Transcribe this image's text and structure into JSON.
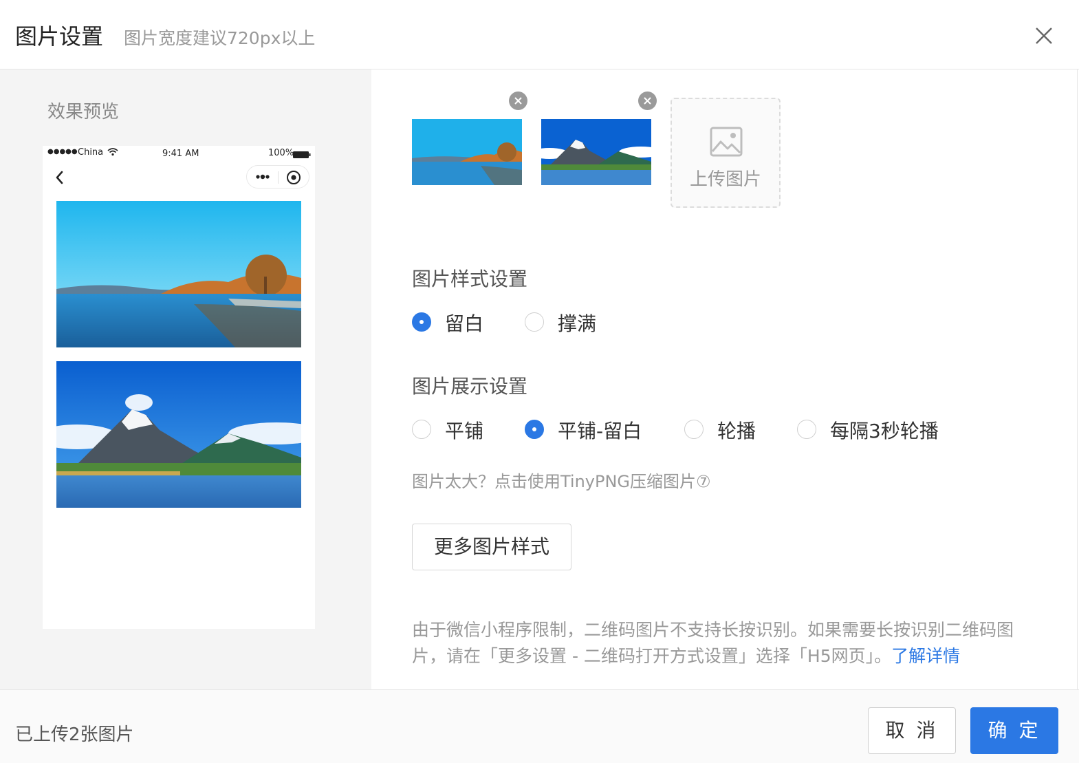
{
  "header": {
    "title": "图片设置",
    "subtitle": "图片宽度建议720px以上"
  },
  "preview": {
    "label": "效果预览",
    "statusbar": {
      "dots": "●●●●●",
      "carrier": "China",
      "time": "9:41 AM",
      "battery": "100%"
    },
    "images": [
      "lake-scene",
      "mountain-scene"
    ]
  },
  "thumbnails": [
    {
      "name": "lake-scene"
    },
    {
      "name": "mountain-scene"
    }
  ],
  "upload": {
    "label": "上传图片"
  },
  "style_setting": {
    "title": "图片样式设置",
    "options": [
      "留白",
      "撑满"
    ],
    "selected": "留白"
  },
  "display_setting": {
    "title": "图片展示设置",
    "options": [
      "平铺",
      "平铺-留白",
      "轮播",
      "每隔3秒轮播"
    ],
    "selected": "平铺-留白"
  },
  "tip": "图片太大？点击使用TinyPNG压缩图片⑦",
  "more_button": "更多图片样式",
  "notice": {
    "text": "由于微信小程序限制，二维码图片不支持长按识别。如果需要长按识别二维码图片，请在「更多设置 - 二维码打开方式设置」选择「H5网页」。",
    "link": "了解详情"
  },
  "footer": {
    "count": "已上传2张图片",
    "cancel": "取 消",
    "ok": "确 定"
  },
  "colors": {
    "accent": "#2b78e4",
    "pane_bg": "#f4f4f4",
    "muted_text": "#999999"
  }
}
